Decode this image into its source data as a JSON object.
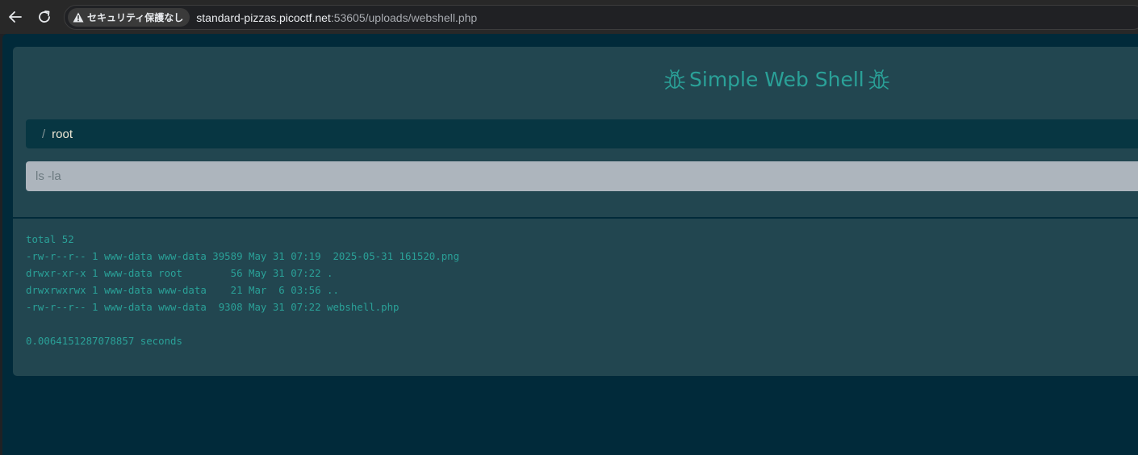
{
  "browser": {
    "security_label": "セキュリティ保護なし",
    "url_host": "standard-pizzas.picoctf.net",
    "url_rest": ":53605/uploads/webshell.php"
  },
  "shell": {
    "title": "Simple Web Shell",
    "breadcrumb": {
      "separator": "/",
      "path": "root"
    },
    "command": {
      "placeholder": "ls -la",
      "value": ""
    },
    "output_lines": [
      "total 52",
      "-rw-r--r-- 1 www-data www-data 39589 May 31 07:19  2025-05-31 161520.png",
      "drwxr-xr-x 1 www-data root        56 May 31 07:22 .",
      "drwxrwxrwx 1 www-data www-data    21 Mar  6 03:56 ..",
      "-rw-r--r-- 1 www-data www-data  9308 May 31 07:22 webshell.php",
      "",
      "0.0064151287078857 seconds"
    ]
  },
  "colors": {
    "page_background": "#012a3a",
    "card_background": "#224650",
    "accent_text": "#2aa198",
    "input_background": "#adb5bd"
  },
  "icons": {
    "back": "arrow-left-icon",
    "reload": "reload-icon",
    "warning": "warning-triangle-icon",
    "title_bug": "bug-icon"
  }
}
